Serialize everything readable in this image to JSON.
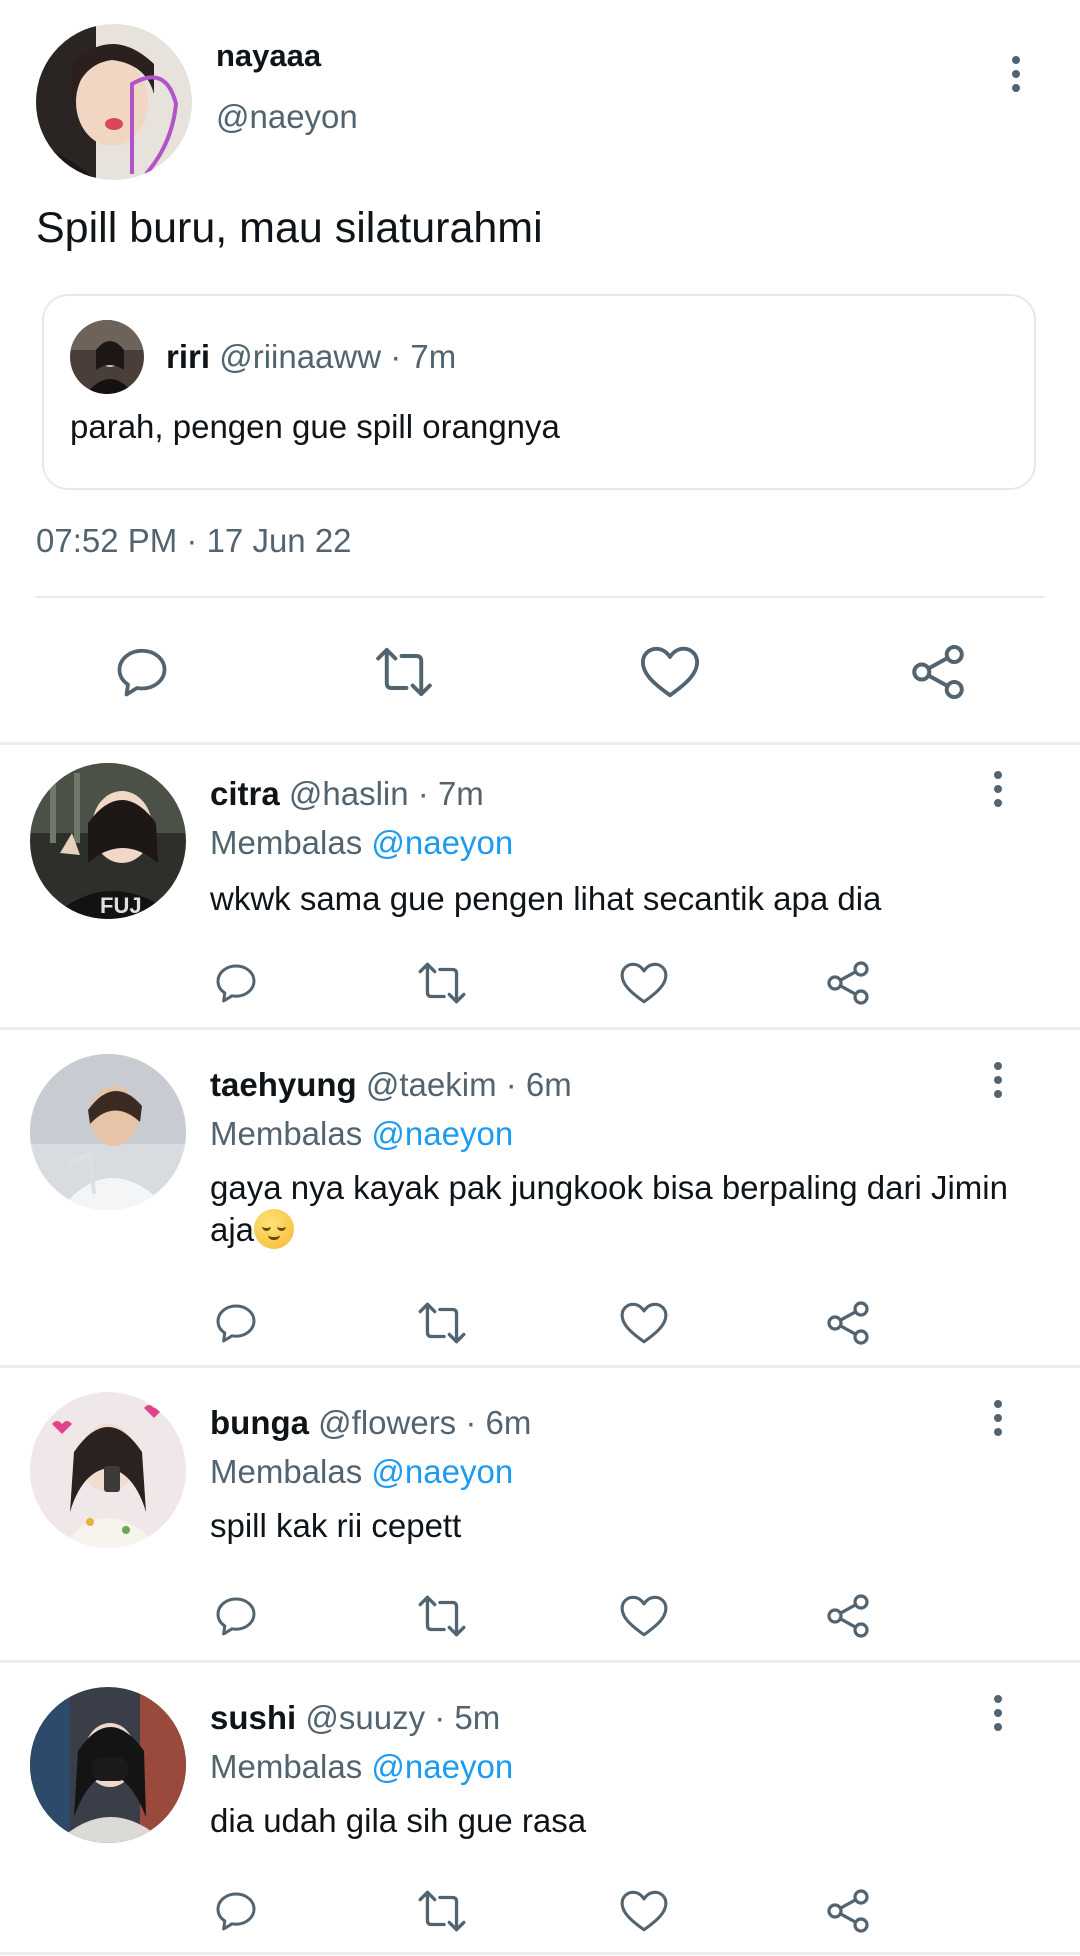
{
  "main_tweet": {
    "author_name": "nayaaa",
    "author_handle": "@naeyon",
    "text": "Spill buru, mau silaturahmi",
    "quoted": {
      "name": "riri",
      "meta": "@riinaaww · 7m",
      "text": "parah, pengen gue spill orangnya"
    },
    "timestamp": "07:52 PM · 17 Jun 22"
  },
  "replies": [
    {
      "name": "citra",
      "meta": "@haslin · 7m",
      "replying_prefix": "Membalas",
      "mention": "@naeyon",
      "text": "wkwk sama gue pengen lihat secantik apa dia"
    },
    {
      "name": "taehyung",
      "meta": "@taekim · 6m",
      "replying_prefix": "Membalas",
      "mention": "@naeyon",
      "text": "gaya nya kayak pak jungkook bisa berpaling dari Jimin aja"
    },
    {
      "name": "bunga",
      "meta": "@flowers · 6m",
      "replying_prefix": "Membalas",
      "mention": "@naeyon",
      "text": "spill kak rii cepett"
    },
    {
      "name": "sushi",
      "meta": "@suuzy · 5m",
      "replying_prefix": "Membalas",
      "mention": "@naeyon",
      "text": "dia udah gila sih gue rasa"
    }
  ],
  "icons": {
    "reply": "reply-icon",
    "retweet": "retweet-icon",
    "like": "heart-icon",
    "share": "share-icon",
    "more": "more-vertical-icon"
  },
  "colors": {
    "text_primary": "#0f1419",
    "text_secondary": "#536471",
    "mention": "#1d9bf0",
    "divider": "#e6e9ec"
  }
}
